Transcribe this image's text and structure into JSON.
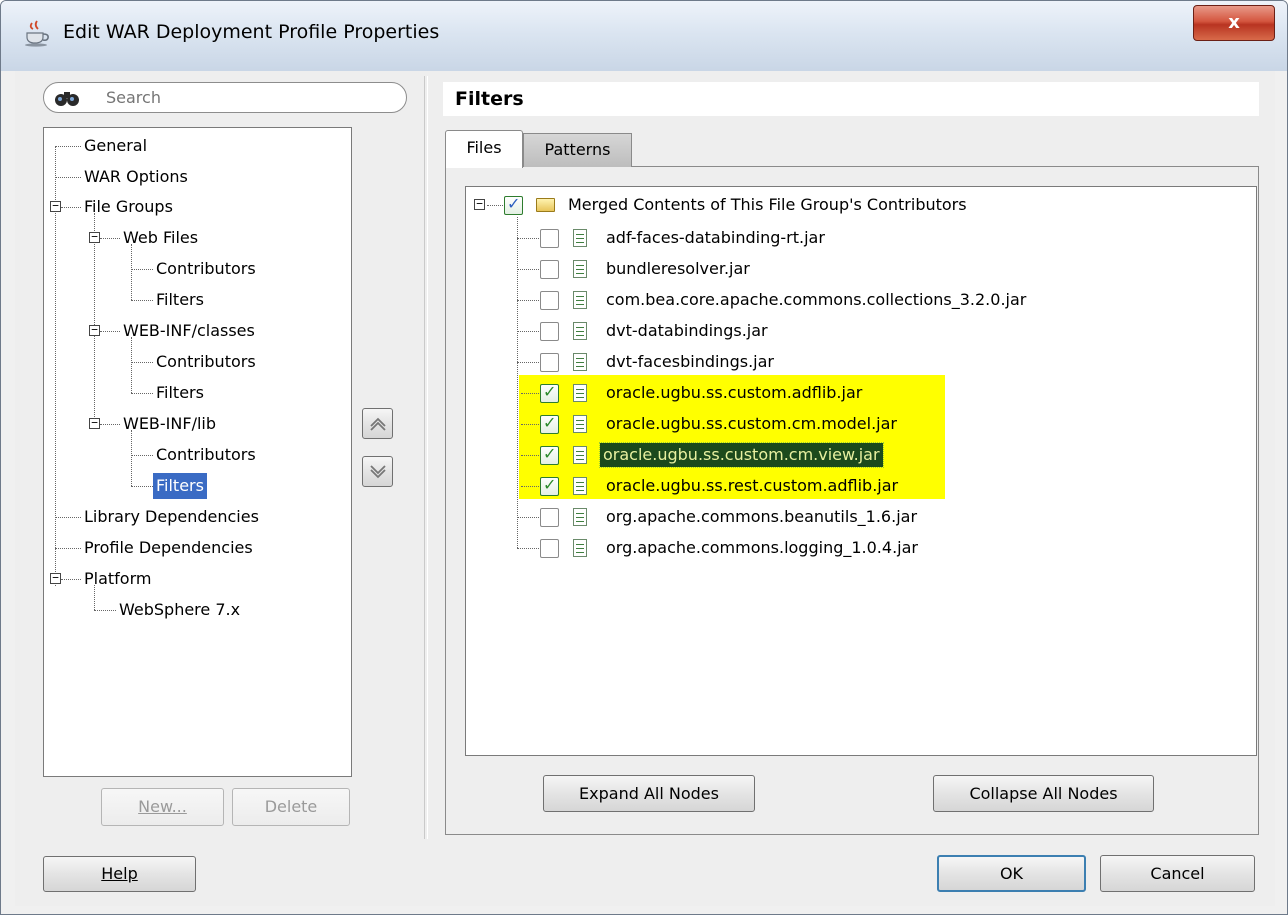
{
  "window": {
    "title": "Edit WAR Deployment Profile Properties",
    "close_label": "x",
    "accent_colors": {
      "selection": "#3a6bc4",
      "highlight": "#ffff00",
      "selected_file_bg": "#1c4a1c"
    }
  },
  "search": {
    "placeholder": "Search",
    "value": ""
  },
  "nav": {
    "items": [
      {
        "label": "General"
      },
      {
        "label": "WAR Options"
      },
      {
        "label": "File Groups",
        "expanded": true
      },
      {
        "label": "Web Files",
        "expanded": true
      },
      {
        "label": "Contributors"
      },
      {
        "label": "Filters"
      },
      {
        "label": "WEB-INF/classes",
        "expanded": true
      },
      {
        "label": "Contributors"
      },
      {
        "label": "Filters"
      },
      {
        "label": "WEB-INF/lib",
        "expanded": true
      },
      {
        "label": "Contributors"
      },
      {
        "label": "Filters",
        "selected": true
      },
      {
        "label": "Library Dependencies"
      },
      {
        "label": "Profile Dependencies"
      },
      {
        "label": "Platform",
        "expanded": true
      },
      {
        "label": "WebSphere 7.x"
      }
    ],
    "new_button": "New...",
    "delete_button": "Delete"
  },
  "panel": {
    "title": "Filters",
    "tabs": [
      {
        "label": "Files",
        "active": true
      },
      {
        "label": "Patterns",
        "active": false
      }
    ],
    "root": {
      "label": "Merged Contents of This File Group's Contributors",
      "checked": true
    },
    "files": [
      {
        "name": "adf-faces-databinding-rt.jar",
        "checked": false
      },
      {
        "name": "bundleresolver.jar",
        "checked": false
      },
      {
        "name": "com.bea.core.apache.commons.collections_3.2.0.jar",
        "checked": false
      },
      {
        "name": "dvt-databindings.jar",
        "checked": false
      },
      {
        "name": "dvt-facesbindings.jar",
        "checked": false
      },
      {
        "name": "oracle.ugbu.ss.custom.adflib.jar",
        "checked": true,
        "highlighted": true
      },
      {
        "name": "oracle.ugbu.ss.custom.cm.model.jar",
        "checked": true,
        "highlighted": true
      },
      {
        "name": "oracle.ugbu.ss.custom.cm.view.jar",
        "checked": true,
        "highlighted": true,
        "selected": true
      },
      {
        "name": "oracle.ugbu.ss.rest.custom.adflib.jar",
        "checked": true,
        "highlighted": true
      },
      {
        "name": "org.apache.commons.beanutils_1.6.jar",
        "checked": false
      },
      {
        "name": "org.apache.commons.logging_1.0.4.jar",
        "checked": false
      }
    ],
    "expand_all": "Expand All Nodes",
    "collapse_all": "Collapse All Nodes"
  },
  "footer": {
    "help": "Help",
    "ok": "OK",
    "cancel": "Cancel"
  }
}
